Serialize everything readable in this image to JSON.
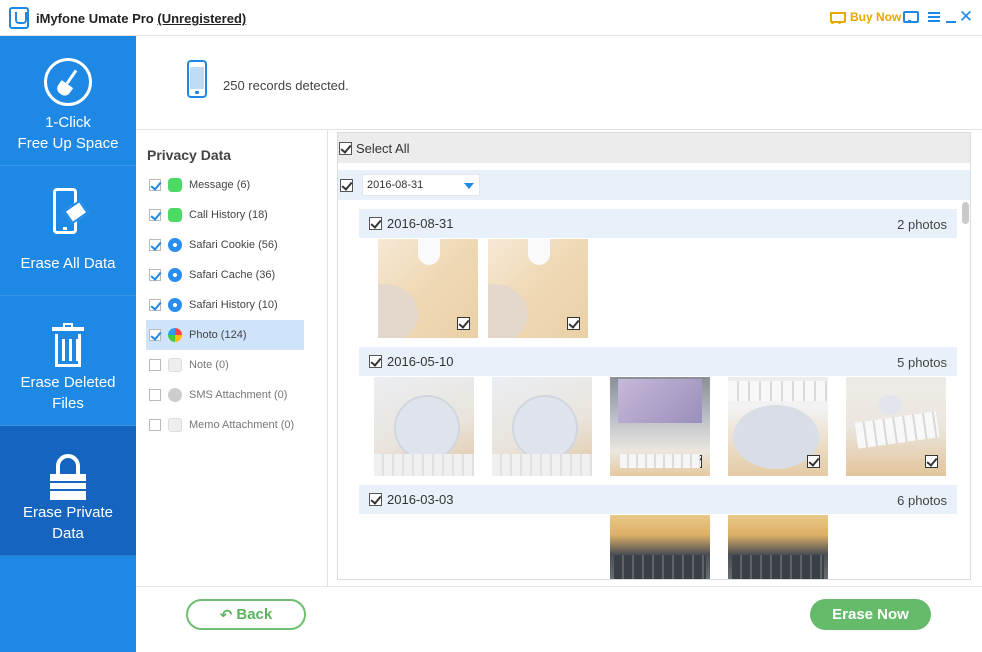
{
  "window": {
    "title": "iMyfone Umate Pro",
    "registration": "(Unregistered)",
    "buy_now": "Buy Now",
    "close_glyph": "✕"
  },
  "sidebar": {
    "items": [
      {
        "line1": "1-Click",
        "line2": "Free Up Space",
        "icon": "broom-icon"
      },
      {
        "line1": "Erase All Data",
        "line2": "",
        "icon": "phone-erase-icon"
      },
      {
        "line1": "Erase Deleted",
        "line2": "Files",
        "icon": "trash-icon"
      },
      {
        "line1": "Erase Private",
        "line2": "Data",
        "icon": "lock-icon",
        "active": true
      }
    ]
  },
  "info": {
    "records": "250 records detected."
  },
  "privacy": {
    "title": "Privacy Data",
    "categories": [
      {
        "label": "Message (6)",
        "checked": true,
        "icon": "message-icon"
      },
      {
        "label": "Call History (18)",
        "checked": true,
        "icon": "phone-icon"
      },
      {
        "label": "Safari Cookie (56)",
        "checked": true,
        "icon": "safari-icon"
      },
      {
        "label": "Safari Cache (36)",
        "checked": true,
        "icon": "safari-icon"
      },
      {
        "label": "Safari History (10)",
        "checked": true,
        "icon": "safari-icon"
      },
      {
        "label": "Photo (124)",
        "checked": true,
        "icon": "photo-icon",
        "selected": true
      },
      {
        "label": "Note (0)",
        "checked": false,
        "icon": "note-icon"
      },
      {
        "label": "SMS Attachment (0)",
        "checked": false,
        "icon": "sms-icon"
      },
      {
        "label": "Memo Attachment (0)",
        "checked": false,
        "icon": "memo-icon"
      }
    ]
  },
  "photos": {
    "select_all": "Select All",
    "date_filter": "2016-08-31",
    "groups": [
      {
        "date": "2016-08-31",
        "count": "2 photos"
      },
      {
        "date": "2016-05-10",
        "count": "5 photos"
      },
      {
        "date": "2016-03-03",
        "count": "6 photos"
      }
    ]
  },
  "buttons": {
    "back": "Back",
    "back_glyph": "↶",
    "erase": "Erase Now"
  },
  "colors": {
    "sidebar": "#1e88e5",
    "sidebar_active": "#1565c0",
    "accent_green": "#66bb6a",
    "buy_now": "#e8a800"
  }
}
